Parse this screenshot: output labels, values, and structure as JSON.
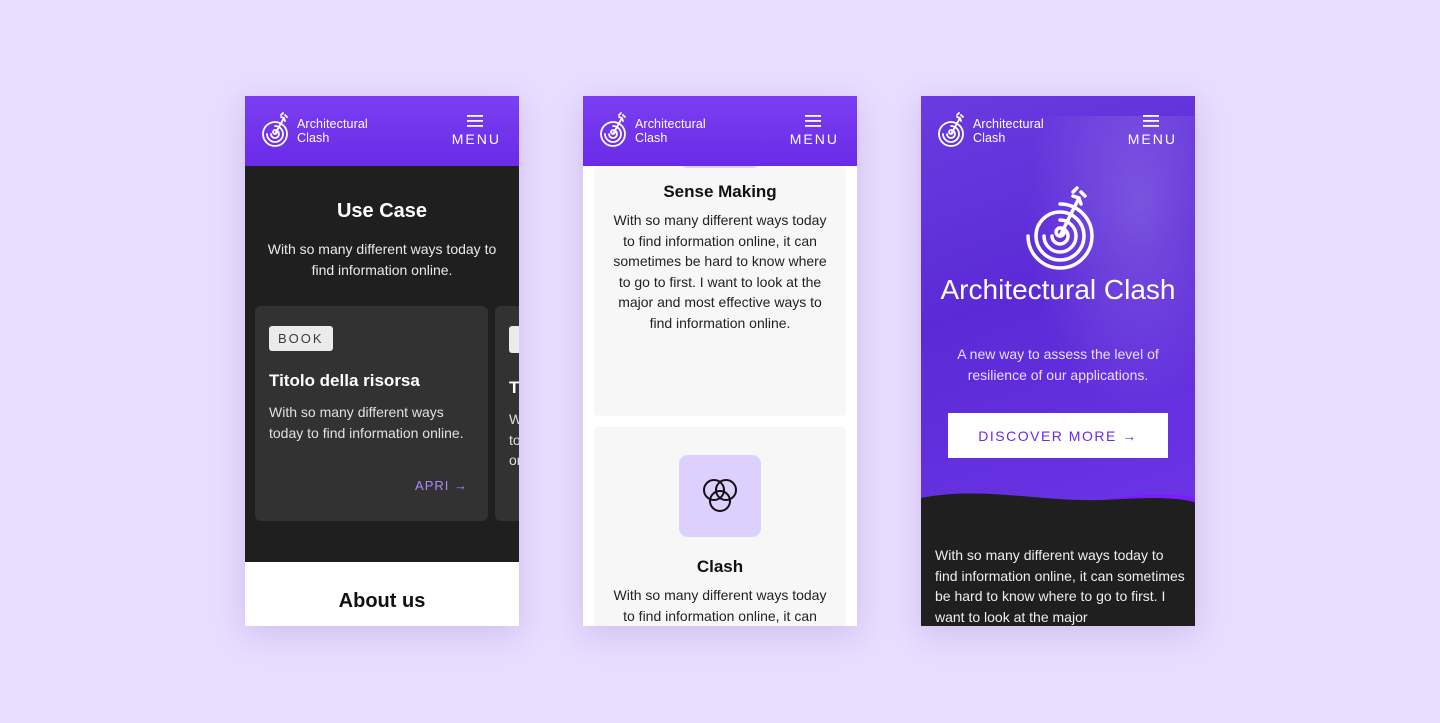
{
  "brand": {
    "name_line1": "Architectural",
    "name_line2": "Clash",
    "menu_label": "MENU"
  },
  "colors": {
    "background": "#e9ddff",
    "purple": "#6a2ae8",
    "dark": "#1f1f1f",
    "accent_link": "#a78bfa",
    "icon_tile": "#dcd0ff"
  },
  "phone1": {
    "section_title": "Use Case",
    "section_subtitle": "With so many different ways today to find information online.",
    "cards": [
      {
        "tag": "BOOK",
        "title": "Titolo della risorsa",
        "description": "With so many different ways today to find information online.",
        "link": "APRI →"
      },
      {
        "tag": "",
        "title": "Ti",
        "description": "Wi to or",
        "link": ""
      }
    ],
    "about_title": "About us"
  },
  "phone2": {
    "cards": [
      {
        "icon": "sense-making-icon",
        "title": "Sense Making",
        "description": "With so many different ways today to find information online, it can sometimes be hard to know where to go to first. I want to look at the major and most effective ways to find information online."
      },
      {
        "icon": "venn-circles-icon",
        "title": "Clash",
        "description": "With so many different ways today to find information online, it can"
      }
    ]
  },
  "phone3": {
    "hero_title": "Architectural Clash",
    "hero_subtitle": "A new way to assess the level of resilience of our applications.",
    "cta": "DISCOVER MORE →",
    "body": "With so many different ways today to find information online, it can sometimes be hard to know where to go to first. I want to look at the major"
  }
}
